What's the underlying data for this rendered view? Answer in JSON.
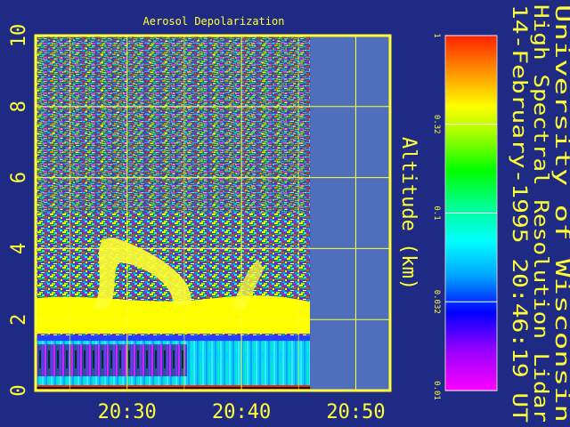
{
  "chart_data": {
    "type": "heatmap",
    "title": "Aerosol Depolarization",
    "ylabel": "Altitude (km)",
    "xlabel": "",
    "x_tick_labels": [
      "20:30",
      "20:40",
      "20:50"
    ],
    "y_tick_labels": [
      "0",
      "2",
      "4",
      "6",
      "8",
      "10"
    ],
    "xlim": [
      "20:22",
      "20:53"
    ],
    "ylim": [
      0,
      10
    ],
    "grid": true,
    "colorbar": {
      "scale": "log",
      "range": [
        0.01,
        1
      ],
      "tick_labels": [
        "1",
        "0.32",
        "0.1",
        "0.032",
        "0.01"
      ],
      "colors_low_to_high": [
        "#ff00ff",
        "#8f00ff",
        "#0000ff",
        "#00a0ff",
        "#00ffff",
        "#00ff90",
        "#00ff00",
        "#a0ff00",
        "#ffff00",
        "#ff9000",
        "#ff2000"
      ]
    },
    "data_end_time": "20:46",
    "no_data_color": "#4f6fbd",
    "features": [
      {
        "name": "aerosol layer",
        "altitude_km": [
          1.6,
          2.6
        ],
        "depolarization": 0.32
      },
      {
        "name": "plume",
        "altitude_km": [
          2.3,
          4.5
        ],
        "time": [
          "20:27",
          "20:36"
        ],
        "depolarization": 0.32
      },
      {
        "name": "boundary layer",
        "altitude_km": [
          0.2,
          1.5
        ],
        "depolarization": 0.05
      }
    ],
    "side_title_lines": [
      "University of Wisconsin",
      "High Spectral Resolution Lidar",
      "14-February-1995 20:46:19 UT"
    ]
  }
}
